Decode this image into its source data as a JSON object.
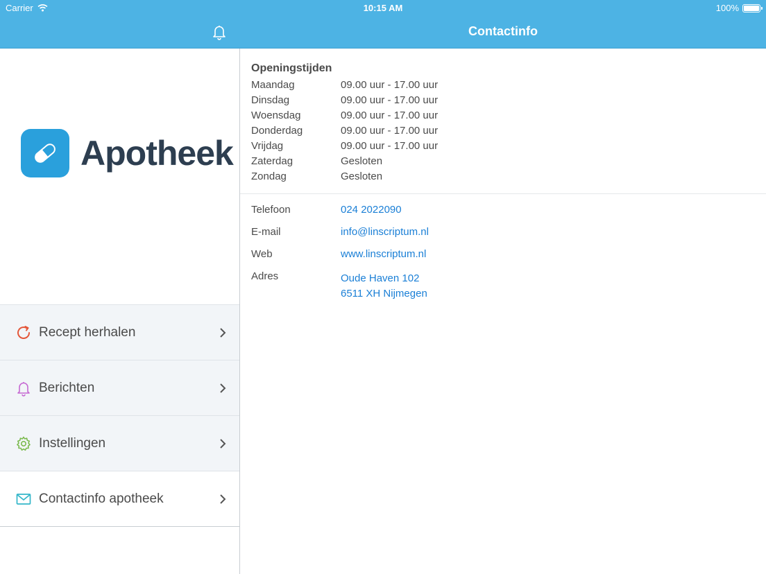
{
  "status": {
    "carrier": "Carrier",
    "time": "10:15 AM",
    "battery": "100%"
  },
  "sidebar": {
    "logo_text": "Apotheek",
    "menu": [
      {
        "label": "Recept herhalen",
        "icon": "refresh-icon",
        "color": "#e4573a"
      },
      {
        "label": "Berichten",
        "icon": "bell-icon",
        "color": "#c66ad3"
      },
      {
        "label": "Instellingen",
        "icon": "gear-icon",
        "color": "#7cba4f"
      },
      {
        "label": "Contactinfo apotheek",
        "icon": "mail-icon",
        "color": "#33b6c9"
      }
    ]
  },
  "main": {
    "title": "Contactinfo",
    "hours_title": "Openingstijden",
    "hours": [
      {
        "day": "Maandag",
        "time": "09.00 uur - 17.00 uur"
      },
      {
        "day": "Dinsdag",
        "time": "09.00 uur - 17.00 uur"
      },
      {
        "day": "Woensdag",
        "time": "09.00 uur - 17.00 uur"
      },
      {
        "day": "Donderdag",
        "time": "09.00 uur - 17.00 uur"
      },
      {
        "day": "Vrijdag",
        "time": "09.00 uur - 17.00 uur"
      },
      {
        "day": "Zaterdag",
        "time": "Gesloten"
      },
      {
        "day": "Zondag",
        "time": "Gesloten"
      }
    ],
    "contact": {
      "phone_label": "Telefoon",
      "phone": "024 2022090",
      "email_label": "E-mail",
      "email": "info@linscriptum.nl",
      "web_label": "Web",
      "web": "www.linscriptum.nl",
      "address_label": "Adres",
      "address_line1": "Oude Haven 102",
      "address_line2": "6511 XH Nijmegen"
    }
  },
  "colors": {
    "header": "#4db3e4",
    "logo": "#2aa0dc",
    "link": "#1a7fd6"
  }
}
